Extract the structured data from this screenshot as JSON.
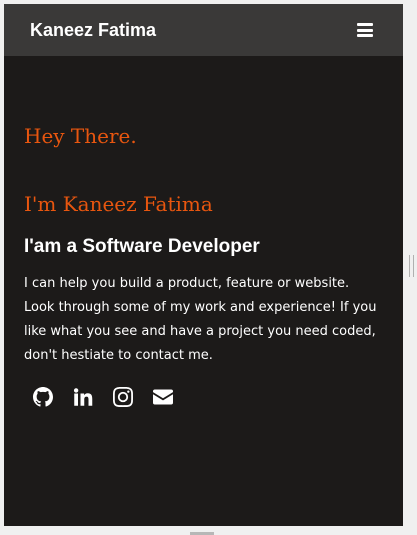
{
  "navbar": {
    "brand": "Kaneez Fatima",
    "menu_icon": "hamburger-menu-icon"
  },
  "hero": {
    "greeting": "Hey There.",
    "name": "I'm Kaneez Fatima",
    "role": "I'am a Software Developer",
    "intro": "I can help you build a product, feature or website. Look through some of my work and experience! If you like what you see and have a project you need coded, don't hestiate to contact me."
  },
  "socials": [
    {
      "icon": "github-icon"
    },
    {
      "icon": "linkedin-icon"
    },
    {
      "icon": "instagram-icon"
    },
    {
      "icon": "email-icon"
    }
  ],
  "colors": {
    "background": "#1c1a19",
    "navbar": "#3a3938",
    "accent": "#e8560f",
    "text": "#ffffff"
  }
}
